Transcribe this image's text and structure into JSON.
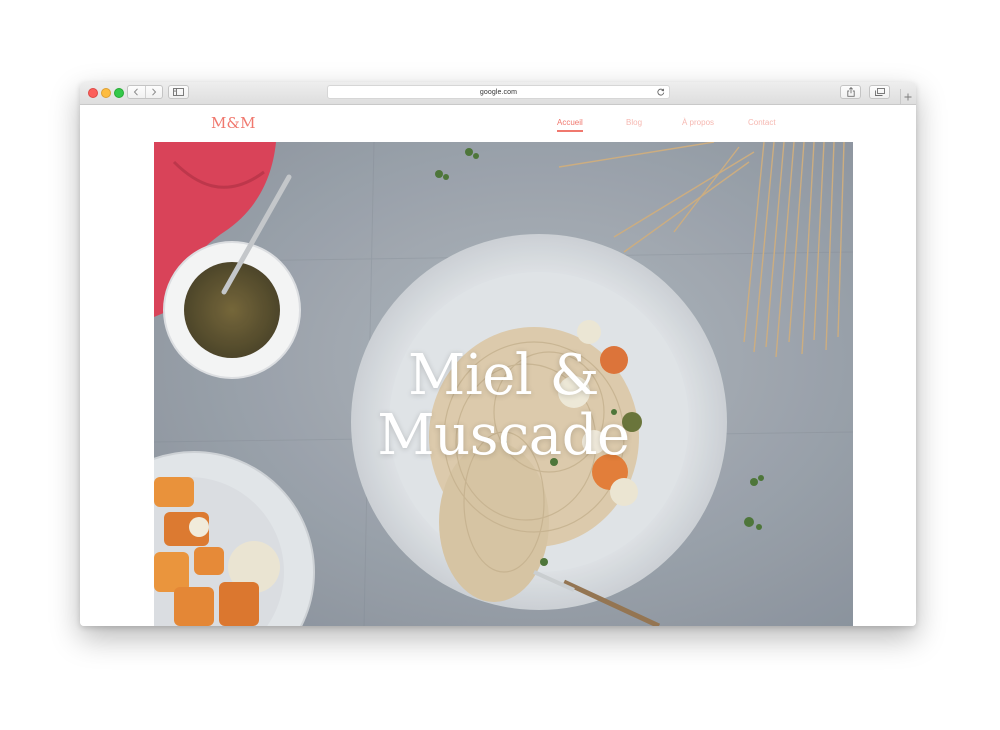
{
  "browser": {
    "address": "google.com",
    "icons": {
      "back": "chevron-left-icon",
      "forward": "chevron-right-icon",
      "sidebar": "sidebar-icon",
      "reload": "reload-icon",
      "share": "share-icon",
      "tabs": "tabs-icon",
      "new_tab": "plus-icon"
    }
  },
  "site": {
    "logo": "M&M",
    "nav": [
      {
        "label": "Accueil",
        "active": true
      },
      {
        "label": "Blog",
        "active": false
      },
      {
        "label": "À propos",
        "active": false
      },
      {
        "label": "Contact",
        "active": false
      }
    ],
    "hero": {
      "title_line1": "Miel &",
      "title_line2": "Muscade"
    }
  },
  "colors": {
    "brand": "#f0786e",
    "nav_inactive": "#f6b8b1",
    "hero_text": "#ffffff"
  }
}
